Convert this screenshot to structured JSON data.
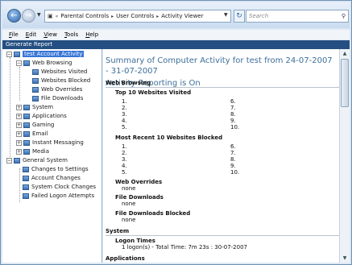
{
  "address_bar": {
    "breadcrumbs": [
      "Parental Controls",
      "User Controls",
      "Activity Viewer"
    ],
    "search_placeholder": "Search"
  },
  "menu": [
    "File",
    "Edit",
    "View",
    "Tools",
    "Help"
  ],
  "menu_underline": [
    "F",
    "E",
    "V",
    "T",
    "H"
  ],
  "menu_rest": [
    "ile",
    "dit",
    "iew",
    "ools",
    "elp"
  ],
  "toolbar": {
    "generate_report": "Generate Report"
  },
  "tree": {
    "root": "test Account Activity",
    "web_browsing": "Web Browsing",
    "web_children": [
      "Websites Visited",
      "Websites Blocked",
      "Web Overrides",
      "File Downloads"
    ],
    "categories": [
      "System",
      "Applications",
      "Gaming",
      "Email",
      "Instant Messaging",
      "Media"
    ],
    "general_system": "General System",
    "general_children": [
      "Changes to Settings",
      "Account Changes",
      "System Clock Changes",
      "Failed Logon Attempts"
    ]
  },
  "report": {
    "title_line1": "Summary of Computer Activity for test from 24-07-2007 - 31-07-2007",
    "title_line2": "Activity Reporting is On",
    "web_browsing": "Web Browsing",
    "top_visited": "Top 10 Websites Visited",
    "recent_blocked": "Most Recent 10 Websites Blocked",
    "numbers_left": [
      "1.",
      "2.",
      "3.",
      "4.",
      "5."
    ],
    "numbers_right": [
      "6.",
      "7.",
      "8.",
      "9.",
      "10."
    ],
    "web_overrides": "Web Overrides",
    "file_downloads": "File Downloads",
    "file_downloads_blocked": "File Downloads Blocked",
    "none": "none",
    "system": "System",
    "logon_times": "Logon Times",
    "logon_value": "1 logon(s) - Total Time: 7m 23s : 30-07-2007",
    "applications": "Applications"
  }
}
